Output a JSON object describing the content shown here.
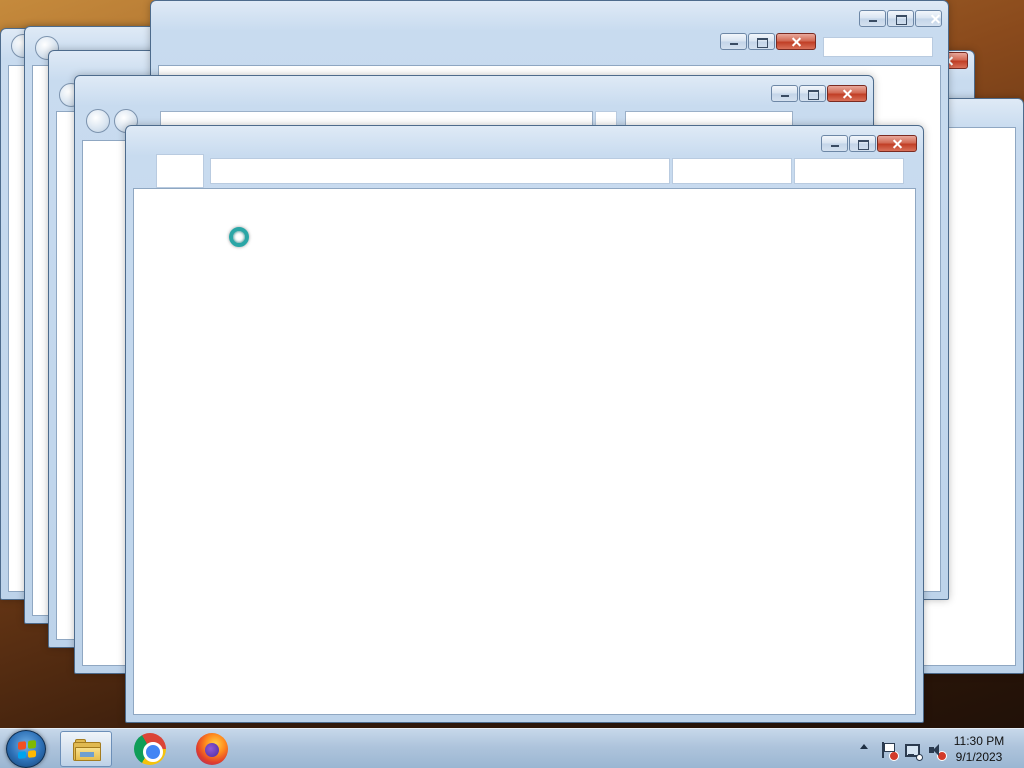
{
  "taskbar": {
    "start_button": "start-orb",
    "pinned": [
      {
        "name": "Windows Explorer",
        "icon": "folder-icon",
        "active": true
      },
      {
        "name": "Google Chrome",
        "icon": "chrome-icon",
        "active": false
      },
      {
        "name": "Mozilla Firefox",
        "icon": "firefox-icon",
        "active": false
      }
    ],
    "tray_icons": [
      "show-hidden-icons-arrow",
      "action-center-flag-icon",
      "network-icon",
      "volume-muted-icon"
    ],
    "clock": {
      "time": "11:30 PM",
      "date": "9/1/2023"
    }
  },
  "windows_open": 7,
  "cursor": "busy-spinner",
  "colors": {
    "frame": "#bdd3ea",
    "close_button": "#c13f26",
    "taskbar": "#aec4dc"
  }
}
